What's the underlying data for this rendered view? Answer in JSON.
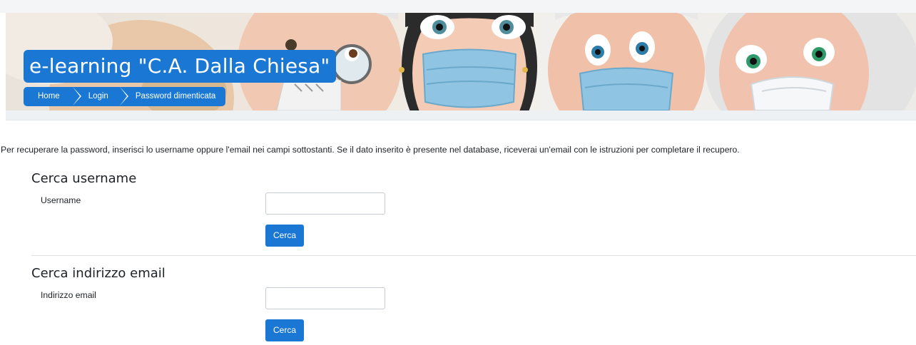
{
  "header": {
    "site_title": "e-learning \"C.A. Dalla Chiesa\"",
    "breadcrumb": [
      {
        "label": "Home"
      },
      {
        "label": "Login"
      },
      {
        "label": "Password dimenticata"
      }
    ]
  },
  "main": {
    "intro": "Per recuperare la password, inserisci lo username oppure l'email nei campi sottostanti. Se il dato inserito è presente nel database, riceverai un'email con le istruzioni per completare il recupero.",
    "username_section": {
      "title": "Cerca username",
      "field_label": "Username",
      "field_value": "",
      "button_label": "Cerca"
    },
    "email_section": {
      "title": "Cerca indirizzo email",
      "field_label": "Indirizzo email",
      "field_value": "",
      "button_label": "Cerca"
    }
  },
  "colors": {
    "accent": "#1a78d4",
    "text": "#1d2125",
    "mask": "#8fc4e2"
  }
}
